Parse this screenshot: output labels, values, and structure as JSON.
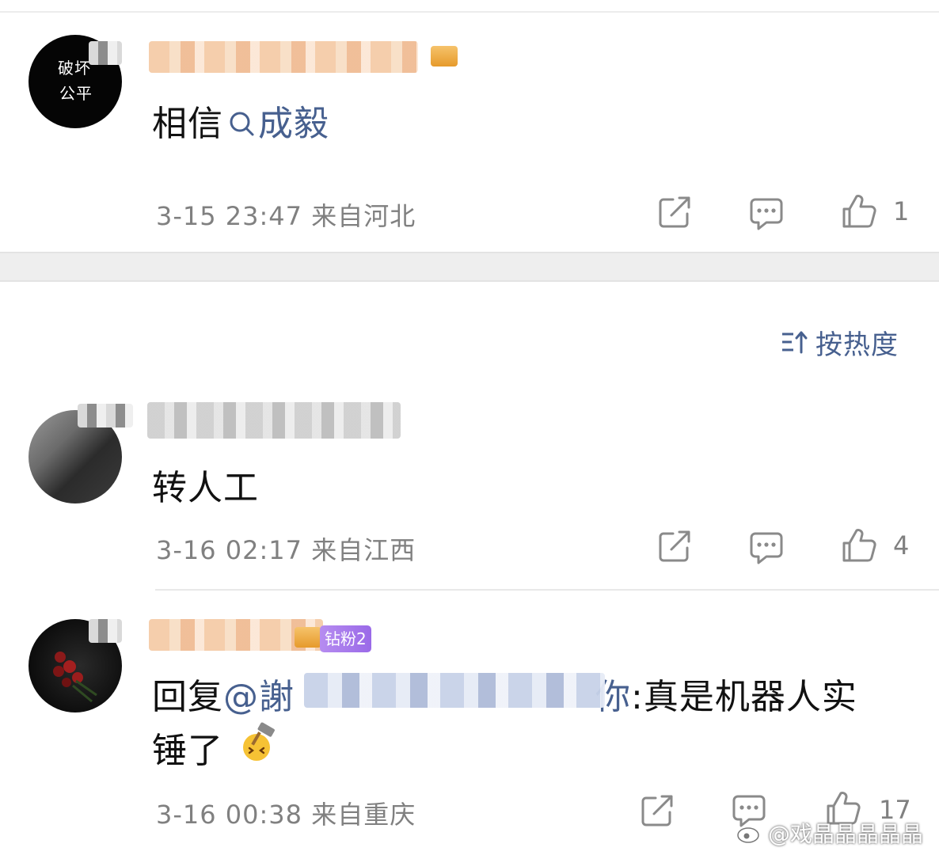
{
  "comments": [
    {
      "avatar_text_line1": "破坏",
      "avatar_text_line2": "公平",
      "text_prefix": "相信",
      "search_link": "成毅",
      "date": "3-15 23:47",
      "location": "来自河北",
      "like_count": "1"
    },
    {
      "text": "转人工",
      "date": "3-16 02:17",
      "location": "来自江西",
      "like_count": "4"
    },
    {
      "badge": "钻粉2",
      "reply_prefix": "回复",
      "mention_prefix": "@謝",
      "mention_suffix": "你",
      "reply_text_line1": ":真是机器人实",
      "reply_text_line2": "锤了",
      "date": "3-16 00:38",
      "location": "来自重庆",
      "like_count": "17"
    }
  ],
  "sort_label": "按热度",
  "watermark_text": "@戏晶晶晶晶晶",
  "icons": [
    "share-icon",
    "comment-icon",
    "like-icon",
    "sort-icon",
    "search-icon",
    "weibo-logo-icon",
    "hammer-emoji-icon"
  ],
  "colors": {
    "link": "#47608f",
    "meta": "#808080",
    "fan_badge": "#a779ec"
  }
}
